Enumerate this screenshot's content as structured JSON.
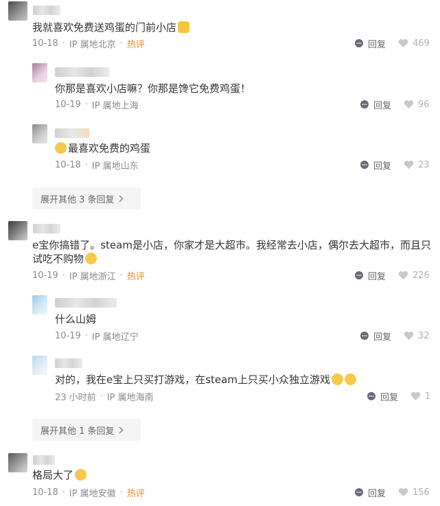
{
  "comments": [
    {
      "text": "我就喜欢免费送鸡蛋的门前小店",
      "date": "10-18",
      "ip": "IP 属地北京",
      "hot": "热评",
      "reply": "回复",
      "likes": "469",
      "replies": [
        {
          "text": "你那是喜欢小店嘛？你那是馋它免费鸡蛋！",
          "date": "10-19",
          "ip": "IP 属地上海",
          "reply": "回复",
          "likes": "96"
        },
        {
          "text": "最喜欢免费的鸡蛋",
          "date": "10-18",
          "ip": "IP 属地山东",
          "reply": "回复",
          "likes": "23"
        }
      ],
      "expand": "展开其他 3 条回复"
    },
    {
      "text_line1": "e宝你搞错了。steam是小店，你家才是大超市。我经常去小店，偶尔去大超市，而且只",
      "text_line2": "试吃不购物",
      "date": "10-19",
      "ip": "IP 属地浙江",
      "hot": "热评",
      "reply": "回复",
      "likes": "226",
      "replies": [
        {
          "text": "什么山姆",
          "date": "10-19",
          "ip": "IP 属地辽宁",
          "reply": "回复",
          "likes": "32"
        },
        {
          "text": "对的，我在e宝上只买打游戏，在steam上只买小众独立游戏",
          "date": "23 小时前",
          "ip": "IP 属地海南",
          "reply": "回复",
          "likes": "1"
        }
      ],
      "expand": "展开其他 1 条回复"
    },
    {
      "text": "格局大了",
      "date": "10-18",
      "ip": "IP 属地安徽",
      "hot": "热评",
      "reply": "回复",
      "likes": "156"
    }
  ],
  "icons": {
    "reply": "comment-bubble-icon",
    "like": "heart-icon",
    "expand": "chevron-right-icon"
  },
  "colors": {
    "hot": "#f08a24",
    "meta": "#8a8a8a",
    "expand_bg": "#f5f5f5"
  }
}
